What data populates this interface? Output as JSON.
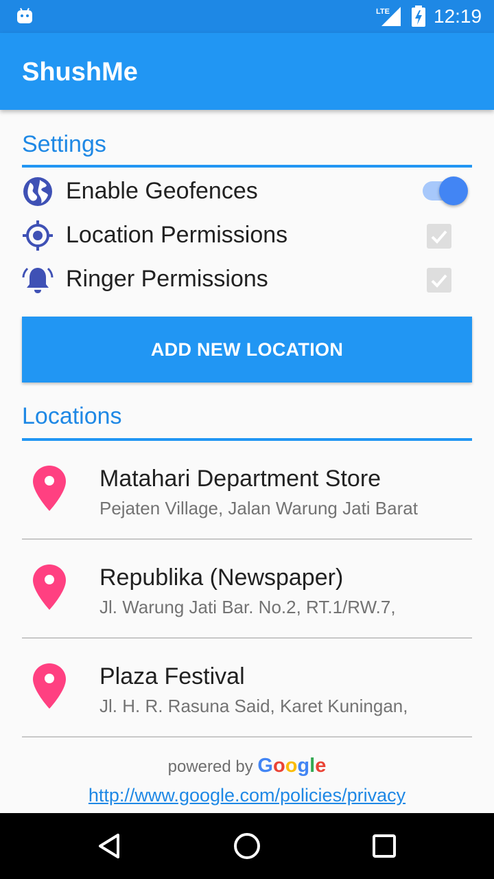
{
  "status_bar": {
    "time": "12:19",
    "network": "LTE",
    "icons": [
      "android-icon",
      "signal-icon",
      "battery-charging-icon"
    ]
  },
  "app_bar": {
    "title": "ShushMe"
  },
  "settings": {
    "header": "Settings",
    "items": [
      {
        "label": "Enable Geofences",
        "icon": "globe-icon",
        "control": "toggle",
        "checked": true
      },
      {
        "label": "Location Permissions",
        "icon": "gps-target-icon",
        "control": "checkbox",
        "checked": true
      },
      {
        "label": "Ringer Permissions",
        "icon": "bell-ringing-icon",
        "control": "checkbox",
        "checked": true
      }
    ]
  },
  "add_button": {
    "label": "ADD NEW LOCATION"
  },
  "locations": {
    "header": "Locations",
    "items": [
      {
        "name": "Matahari Department Store",
        "address": "Pejaten Village, Jalan Warung Jati Barat"
      },
      {
        "name": "Republika (Newspaper)",
        "address": "Jl. Warung Jati Bar. No.2, RT.1/RW.7,"
      },
      {
        "name": "Plaza Festival",
        "address": "Jl. H. R. Rasuna Said, Karet Kuningan,"
      }
    ]
  },
  "footer": {
    "powered_by": "powered by",
    "google_letters": [
      "G",
      "o",
      "o",
      "g",
      "l",
      "e"
    ],
    "privacy_url": "http://www.google.com/policies/privacy"
  },
  "colors": {
    "primary": "#2196f3",
    "primary_dark": "#1e88e5",
    "pin": "#ff4081",
    "icon_indigo": "#3f51b5",
    "toggle_thumb": "#4285f4"
  }
}
